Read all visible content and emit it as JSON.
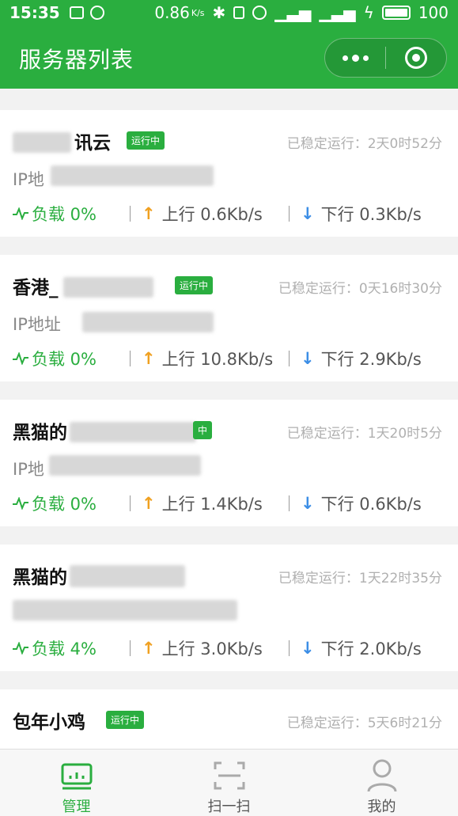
{
  "status_bar": {
    "time": "15:35",
    "speed": "0.86",
    "speed_unit": "K/s",
    "battery": "100"
  },
  "navbar": {
    "title": "服务器列表"
  },
  "servers": [
    {
      "name": "讯云",
      "badge": "运行中",
      "uptime": "已稳定运行：2天0时52分",
      "ip": "IP地",
      "load": "负载 0%",
      "up": "上行 0.6Kb/s",
      "down": "下行 0.3Kb/s"
    },
    {
      "name": "香港_",
      "badge": "运行中",
      "uptime": "已稳定运行：0天16时30分",
      "ip": "IP地址",
      "load": "负载 0%",
      "up": "上行 10.8Kb/s",
      "down": "下行 2.9Kb/s"
    },
    {
      "name": "黑猫的",
      "badge": "中",
      "uptime": "已稳定运行：1天20时5分",
      "ip": "IP地",
      "load": "负载 0%",
      "up": "上行 1.4Kb/s",
      "down": "下行 0.6Kb/s"
    },
    {
      "name": "黑猫的",
      "badge": "",
      "uptime": "已稳定运行：1天22时35分",
      "ip": "",
      "load": "负载 4%",
      "up": "上行 3.0Kb/s",
      "down": "下行 2.0Kb/s"
    },
    {
      "name": "包年小鸡",
      "badge": "运行中",
      "uptime": "已稳定运行：5天6时21分",
      "ip": "",
      "load": "",
      "up": "",
      "down": ""
    }
  ],
  "tabbar": {
    "items": [
      {
        "label": "管理",
        "icon": "dashboard-icon",
        "active": true
      },
      {
        "label": "扫一扫",
        "icon": "scan-icon",
        "active": false
      },
      {
        "label": "我的",
        "icon": "user-icon",
        "active": false
      }
    ]
  },
  "colors": {
    "brand_green": "#2aae3f",
    "upload_orange": "#f0a020",
    "download_blue": "#3c8ee6"
  }
}
